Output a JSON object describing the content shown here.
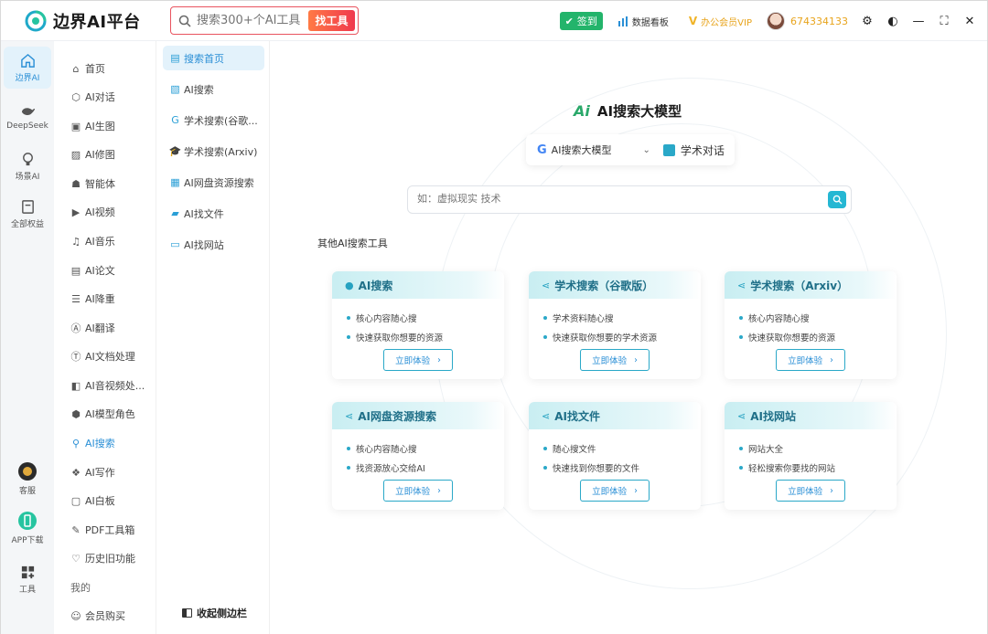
{
  "app": {
    "title": "边界AI平台"
  },
  "top_search": {
    "placeholder": "搜索300+个AI工具",
    "button": "找工具"
  },
  "topbar": {
    "signin": "签到",
    "data_board": "数据看板",
    "vip": "办公会员VIP",
    "user_id": "674334133"
  },
  "rail": [
    {
      "label": "边界AI",
      "icon": "home-icon",
      "active": true
    },
    {
      "label": "DeepSeek",
      "icon": "whale-icon"
    },
    {
      "label": "场景AI",
      "icon": "bulb-icon"
    },
    {
      "label": "全部权益",
      "icon": "rights-icon"
    },
    {
      "label": "客服",
      "icon": "customer-service-icon"
    },
    {
      "label": "APP下载",
      "icon": "phone-download-icon"
    },
    {
      "label": "工具",
      "icon": "tools-grid-icon"
    }
  ],
  "categories": [
    {
      "label": "首页",
      "icon": "home-icon"
    },
    {
      "label": "AI对话",
      "icon": "cube-icon"
    },
    {
      "label": "AI生图",
      "icon": "image-icon"
    },
    {
      "label": "AI修图",
      "icon": "photo-edit-icon"
    },
    {
      "label": "智能体",
      "icon": "robot-icon"
    },
    {
      "label": "AI视频",
      "icon": "play-icon"
    },
    {
      "label": "AI音乐",
      "icon": "music-icon"
    },
    {
      "label": "AI论文",
      "icon": "paper-icon"
    },
    {
      "label": "AI降重",
      "icon": "list-icon"
    },
    {
      "label": "AI翻译",
      "icon": "translate-icon"
    },
    {
      "label": "AI文档处理",
      "icon": "doc-icon"
    },
    {
      "label": "AI音视频处...",
      "icon": "media-icon"
    },
    {
      "label": "AI模型角色",
      "icon": "model-icon"
    },
    {
      "label": "AI搜索",
      "icon": "search-icon",
      "selected": true
    },
    {
      "label": "AI写作",
      "icon": "write-icon"
    },
    {
      "label": "AI白板",
      "icon": "whiteboard-icon"
    },
    {
      "label": "PDF工具箱",
      "icon": "wrench-icon"
    },
    {
      "label": "历史旧功能",
      "icon": "history-icon"
    },
    {
      "label": "我的",
      "icon": ""
    },
    {
      "label": "会员购买",
      "icon": "member-icon"
    }
  ],
  "submenu": [
    {
      "label": "搜索首页",
      "active": true
    },
    {
      "label": "AI搜索"
    },
    {
      "label": "学术搜索(谷歌..."
    },
    {
      "label": "学术搜索(Arxiv)"
    },
    {
      "label": "AI网盘资源搜索"
    },
    {
      "label": "AI找文件"
    },
    {
      "label": "AI找网站"
    }
  ],
  "collapse_label": "收起侧边栏",
  "main": {
    "title": "AI搜索大模型",
    "model_select": {
      "value": "AI搜索大模型",
      "chat": "学术对话"
    },
    "search_placeholder": "如：虚拟现实 技术",
    "other_tools_label": "其他AI搜索工具",
    "cards": [
      {
        "title": "AI搜索",
        "items": [
          "核心内容随心搜",
          "快速获取你想要的资源"
        ],
        "button": "立即体验"
      },
      {
        "title": "学术搜索（谷歌版）",
        "items": [
          "学术资料随心搜",
          "快速获取你想要的学术资源"
        ],
        "button": "立即体验"
      },
      {
        "title": "学术搜索（Arxiv）",
        "items": [
          "核心内容随心搜",
          "快速获取你想要的资源"
        ],
        "button": "立即体验"
      },
      {
        "title": "AI网盘资源搜索",
        "items": [
          "核心内容随心搜",
          "找资源放心交给AI"
        ],
        "button": "立即体验"
      },
      {
        "title": "AI找文件",
        "items": [
          "随心搜文件",
          "快速找到你想要的文件"
        ],
        "button": "立即体验"
      },
      {
        "title": "AI找网站",
        "items": [
          "网站大全",
          "轻松搜索你要找的网站"
        ],
        "button": "立即体验"
      }
    ]
  },
  "colors": {
    "accent": "#2a8fd6",
    "highlight_border": "#e6505c",
    "teal": "#2aa8c8",
    "signin_green": "#23b46b",
    "vip_gold": "#e8a41c"
  }
}
